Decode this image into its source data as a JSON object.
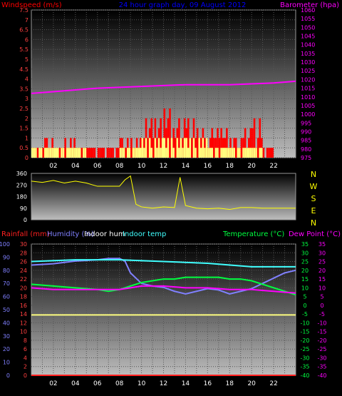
{
  "chart_data": [
    {
      "type": "bar",
      "panel": "wind",
      "title": "24 hour graph day, 09 August 2012",
      "ylabel_left": "Windspeed (m/s)",
      "ylabel_right": "Barometer (hpa)",
      "ylim_left": [
        0,
        7.5
      ],
      "ylim_right": [
        975,
        1060
      ],
      "yticks_left": [
        "0",
        "0.5",
        "1",
        "1.5",
        "2",
        "2.5",
        "3",
        "3.5",
        "4",
        "4.5",
        "5",
        "5.5",
        "6",
        "6.5",
        "7",
        "7.5"
      ],
      "yticks_right": [
        "975",
        "980",
        "985",
        "990",
        "995",
        "1000",
        "1005",
        "1010",
        "1015",
        "1020",
        "1025",
        "1030",
        "1035",
        "1040",
        "1045",
        "1050",
        "1055",
        "1060"
      ],
      "xlim": [
        0,
        24
      ],
      "xticks": [
        "02",
        "04",
        "06",
        "08",
        "10",
        "12",
        "14",
        "16",
        "18",
        "20",
        "22"
      ],
      "grid": true,
      "series": [
        {
          "key": "barometer",
          "color": "#ff00ff",
          "x": [
            0,
            2,
            4,
            6,
            8,
            10,
            12,
            14,
            16,
            18,
            20,
            22,
            24
          ],
          "values": [
            1012,
            1013,
            1014,
            1015,
            1015.5,
            1016,
            1016.5,
            1017,
            1017,
            1017,
            1017.5,
            1018,
            1019
          ]
        },
        {
          "key": "gust",
          "color": "#ff0000",
          "hourly_max": [
            0.5,
            1.0,
            0.5,
            1.0,
            0.5,
            0.5,
            0.5,
            0.5,
            1.0,
            1.0,
            2.0,
            2.0,
            2.5,
            2.0,
            2.0,
            1.5,
            1.5,
            1.5,
            1.0,
            1.5,
            2.0,
            0.5,
            0.0,
            0.0
          ]
        },
        {
          "key": "average",
          "color": "#ffff80",
          "hourly_max": [
            0.5,
            0.5,
            0.5,
            0.5,
            0.5,
            0.0,
            0.0,
            0.0,
            0.5,
            0.5,
            1.0,
            1.0,
            1.0,
            1.0,
            1.0,
            1.0,
            0.5,
            0.5,
            0.5,
            0.5,
            0.5,
            0.0,
            0.0,
            0.0
          ]
        }
      ]
    },
    {
      "type": "scatter",
      "panel": "direction",
      "ylim": [
        0,
        360
      ],
      "yticks": [
        "0",
        "90",
        "180",
        "270",
        "360"
      ],
      "compass_labels": [
        "N",
        "W",
        "S",
        "E",
        "N"
      ],
      "xlim": [
        0,
        24
      ],
      "grid": false,
      "series": [
        {
          "key": "wind direction",
          "color": "#ffff00",
          "x": [
            0,
            1,
            2,
            3,
            4,
            5,
            6,
            7,
            8,
            8.5,
            9,
            9.5,
            10,
            11,
            12,
            13,
            13.5,
            14,
            15,
            16,
            17,
            18,
            19,
            20,
            21,
            22,
            23,
            24
          ],
          "values": [
            300,
            290,
            305,
            285,
            300,
            285,
            260,
            260,
            260,
            310,
            340,
            120,
            100,
            90,
            100,
            95,
            330,
            110,
            90,
            85,
            90,
            80,
            95,
            95,
            90,
            90,
            90,
            90
          ]
        }
      ]
    },
    {
      "type": "line",
      "panel": "temperature",
      "legend": [
        "Rainfall (mm)",
        "Humidity (%)",
        "Indoor hum",
        "Indoor temp",
        "Temperature (°C)",
        "Dew Point (°C)"
      ],
      "ylim_humidity": [
        0,
        100
      ],
      "ylim_rain": [
        0,
        30
      ],
      "ylim_temp": [
        -40,
        35
      ],
      "yticks_humidity": [
        "0",
        "10",
        "20",
        "30",
        "40",
        "50",
        "60",
        "70",
        "80",
        "90",
        "100"
      ],
      "yticks_rain": [
        "0",
        "2",
        "4",
        "6",
        "8",
        "10",
        "12",
        "14",
        "16",
        "18",
        "20",
        "22",
        "24",
        "26",
        "28",
        "30"
      ],
      "yticks_temp": [
        "-40",
        "-35",
        "-30",
        "-25",
        "-20",
        "-15",
        "-10",
        "-5",
        "0",
        "5",
        "10",
        "15",
        "20",
        "25",
        "30",
        "35"
      ],
      "xlim": [
        0,
        24
      ],
      "xticks": [
        "02",
        "04",
        "06",
        "08",
        "10",
        "12",
        "14",
        "16",
        "18",
        "20",
        "22"
      ],
      "grid": true,
      "series": [
        {
          "key": "Humidity (%)",
          "color": "#8080ff",
          "x": [
            0,
            2,
            4,
            6,
            7,
            8,
            8.5,
            9,
            10,
            11,
            12,
            13,
            14,
            15,
            16,
            17,
            18,
            19,
            20,
            21,
            22,
            23,
            24
          ],
          "values": [
            84,
            85,
            87,
            88,
            89,
            89,
            87,
            78,
            70,
            68,
            67,
            64,
            62,
            64,
            66,
            65,
            62,
            64,
            66,
            70,
            74,
            78,
            80
          ]
        },
        {
          "key": "Indoor temp",
          "color": "#40ffff",
          "x": [
            0,
            4,
            8,
            12,
            16,
            20,
            24
          ],
          "values": [
            25,
            26,
            26,
            25,
            24,
            22,
            22
          ]
        },
        {
          "key": "Temperature (°C)",
          "color": "#00ff40",
          "x": [
            0,
            2,
            4,
            6,
            7,
            8,
            9,
            10,
            11,
            12,
            13,
            14,
            15,
            16,
            17,
            18,
            19,
            20,
            21,
            22,
            23,
            24
          ],
          "values": [
            12,
            11,
            10,
            9,
            8,
            9,
            11,
            13,
            14,
            15,
            15,
            16,
            16,
            16,
            16,
            15,
            15,
            14,
            12,
            10,
            8,
            6
          ]
        },
        {
          "key": "Dew Point (°C)",
          "color": "#ff00ff",
          "x": [
            0,
            2,
            4,
            6,
            8,
            9,
            10,
            12,
            14,
            16,
            18,
            20,
            22,
            24
          ],
          "values": [
            10,
            9,
            9,
            9,
            9,
            10,
            11,
            11,
            10,
            10,
            9,
            9,
            8,
            7
          ]
        },
        {
          "key": "Indoor hum",
          "color": "#ffff80",
          "x": [
            0,
            24
          ],
          "values": [
            46,
            46
          ]
        },
        {
          "key": "Rainfall (mm)",
          "color": "#ff2020",
          "x": [
            0,
            24
          ],
          "values": [
            0,
            0
          ]
        }
      ]
    }
  ]
}
